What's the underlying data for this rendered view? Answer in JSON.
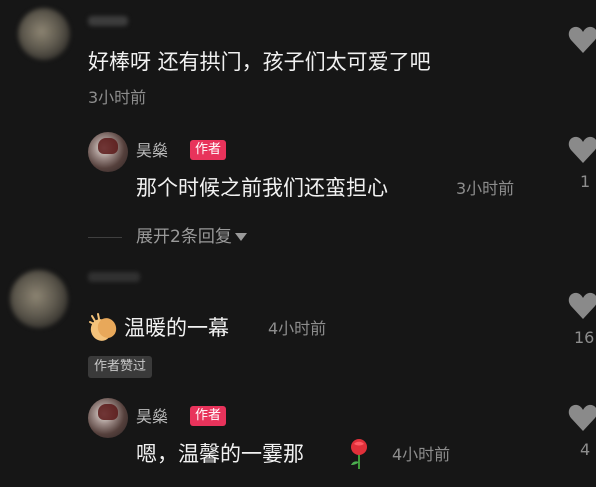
{
  "comments": [
    {
      "text": "好棒呀 还有拱门，孩子们太可爱了吧",
      "time": "3小时前",
      "reply": {
        "username": "昊燊",
        "badge": "作者",
        "text": "那个时候之前我们还蛮担心",
        "time": "3小时前",
        "like_count": "1"
      },
      "expand_label": "展开2条回复"
    },
    {
      "text": "温暖的一幕",
      "time": "4小时前",
      "liked_badge": "作者赞过",
      "like_count": "16",
      "reply": {
        "username": "昊燊",
        "badge": "作者",
        "text": "嗯，温馨的一霎那",
        "time": "4小时前",
        "like_count": "4"
      }
    }
  ],
  "icons": {
    "heart": "heart-icon",
    "clap": "clapping-hands-emoji",
    "rose": "rose-emoji",
    "caret": "caret-down-icon"
  },
  "colors": {
    "background": "#161616",
    "author_badge": "#e8335b",
    "heart": "#8a8a8a"
  }
}
